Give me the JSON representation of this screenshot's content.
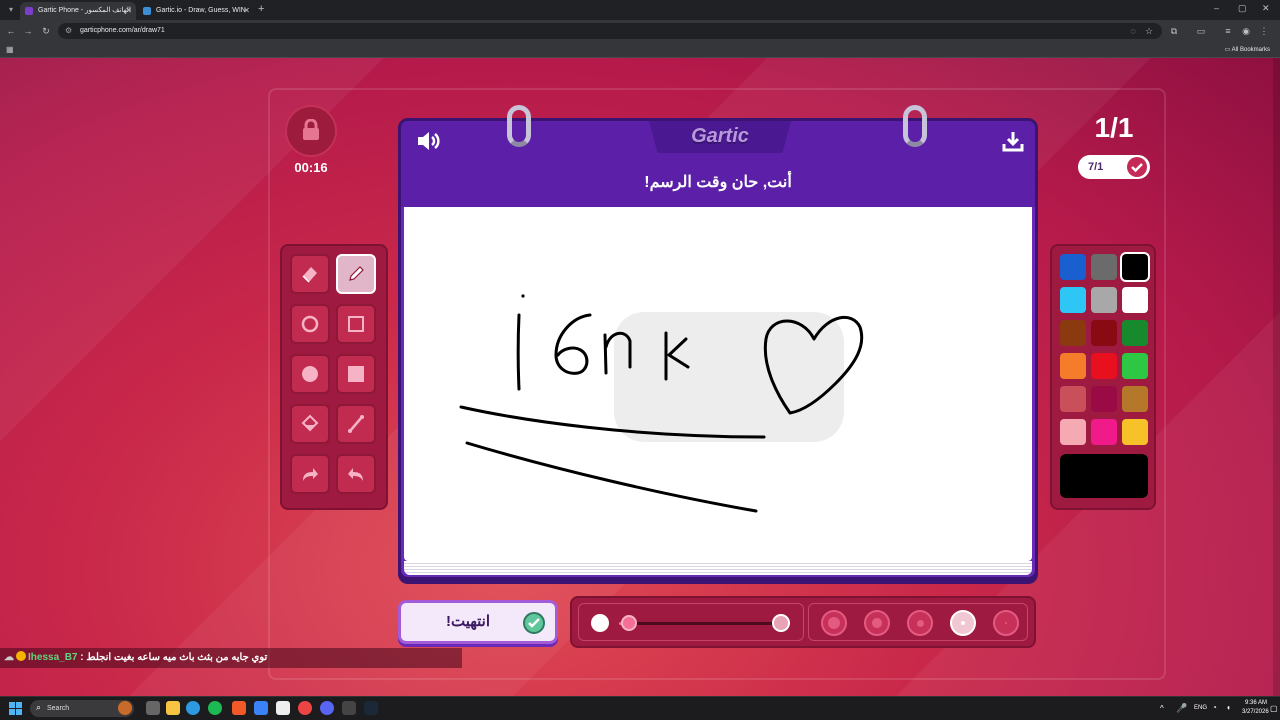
{
  "browser": {
    "tabs": [
      {
        "title": "Gartic Phone - الهاتف المكسور",
        "active": true
      },
      {
        "title": "Gartic.io - Draw, Guess, WIN",
        "active": false
      }
    ],
    "url": "garticphone.com/ar/draw71",
    "bookmarks_label": "All Bookmarks"
  },
  "game": {
    "timer": "00:16",
    "round": "1/1",
    "players": "7/1",
    "logo": "Gartic",
    "prompt": "أنت, حان وقت الرسم!",
    "drawing_text": "isnk",
    "done_label": "انتهيت!",
    "colors": {
      "swatches": [
        "#1a5fd0",
        "#6b6b6b",
        "#000000",
        "#2ec6f5",
        "#a8a8a8",
        "#ffffff",
        "#8b3a10",
        "#8a0a14",
        "#178a2e",
        "#f47c2b",
        "#e8101e",
        "#2ec744",
        "#c94f5a",
        "#9a0a45",
        "#b5782a",
        "#f5a9b3",
        "#f01a8a",
        "#f7c12a"
      ],
      "selected": "#000000",
      "current": "#000000"
    },
    "brush_sizes": {
      "count": 5,
      "selected_index": 3
    }
  },
  "chat": {
    "username": "Ihessa_B7",
    "message": "توي جايه من بثث باث ميه ساعه بغيت انجلط :"
  },
  "taskbar": {
    "search_label": "Search",
    "lang": "ENG",
    "time": "9:36 AM",
    "date": "3/27/2026"
  }
}
